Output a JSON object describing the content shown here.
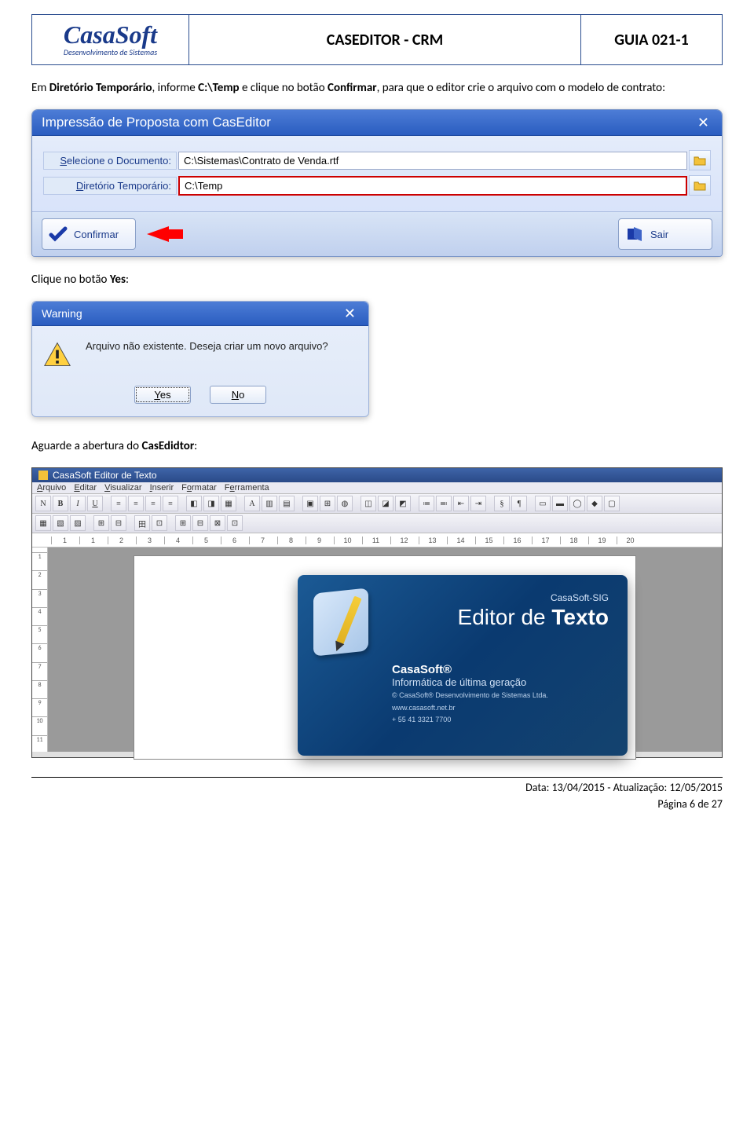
{
  "header": {
    "logo_name": "CasaSoft",
    "logo_sub": "Desenvolvimento de Sistemas",
    "title": "CASEDITOR - CRM",
    "guide": "GUIA 021-1"
  },
  "para1_pre": "Em ",
  "para1_b1": "Diretório Temporário",
  "para1_mid": ", informe ",
  "para1_b2": "C:\\Temp",
  "para1_mid2": " e clique no botão ",
  "para1_b3": "Confirmar",
  "para1_end": ", para que o editor crie o arquivo com o modelo de contrato:",
  "dialog1": {
    "title": "Impressão de Proposta com CasEditor",
    "label_doc_pre": "S",
    "label_doc_rest": "elecione o Documento:",
    "value_doc": "C:\\Sistemas\\Contrato de Venda.rtf",
    "label_dir_pre": "D",
    "label_dir_rest": "iretório Temporário:",
    "value_dir": "C:\\Temp",
    "btn_confirmar": "Confirmar",
    "btn_sair": "Sair"
  },
  "para2_pre": "Clique no botão ",
  "para2_b": "Yes",
  "para2_end": ":",
  "warning": {
    "title": "Warning",
    "msg": "Arquivo não existente. Deseja criar um novo arquivo?",
    "btn_yes": "Yes",
    "btn_no": "No"
  },
  "para3_pre": "Aguarde a abertura do ",
  "para3_b": "CasEdidtor",
  "para3_end": ":",
  "editor": {
    "title": "CasaSoft Editor de Texto",
    "menu": [
      "Arquivo",
      "Editar",
      "Visualizar",
      "Inserir",
      "Formatar",
      "Ferramenta"
    ],
    "ruler_marks": [
      "1",
      "1",
      "2",
      "3",
      "4",
      "5",
      "6",
      "7",
      "8",
      "9",
      "10",
      "11",
      "12",
      "13",
      "14",
      "15",
      "16",
      "17",
      "18",
      "19",
      "20"
    ],
    "vruler_marks": [
      "1",
      "2",
      "3",
      "4",
      "5",
      "6",
      "7",
      "8",
      "9",
      "10",
      "11"
    ]
  },
  "splash": {
    "brand": "CasaSoft-SIG",
    "title_pre": "Editor de ",
    "title_b": "Texto",
    "block": "CasaSoft®",
    "sub": "Informática de última geração",
    "copy": "© CasaSoft® Desenvolvimento de Sistemas Ltda.",
    "site": "www.casasoft.net.br",
    "phone": "+ 55 41 3321 7700"
  },
  "footer": {
    "line1": "Data: 13/04/2015  -  Atualização: 12/05/2015",
    "line2": "Página 6 de 27"
  }
}
